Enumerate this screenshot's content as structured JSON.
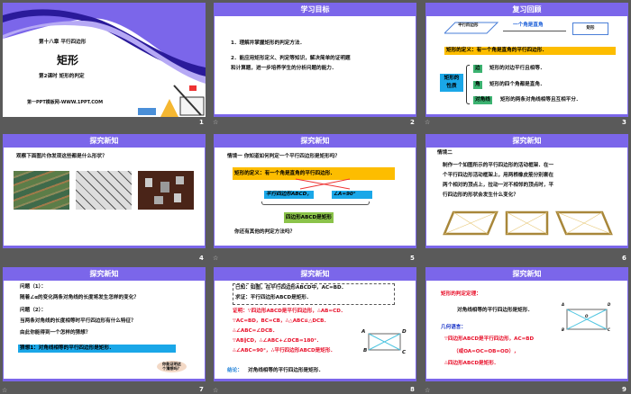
{
  "slides": [
    {
      "number": "1",
      "chapter": "第十八章  平行四边形",
      "title": "矩形",
      "lesson": "第2课时  矩形的判定",
      "site": "第一PPT模板网-WWW.1PPT.COM"
    },
    {
      "number": "2",
      "header": "学习目标",
      "items": [
        "1．理解并掌握矩形的判定方法．",
        "2．能应用矩形定义、判定等知识，解决简单的证明题",
        "和计算题，进一步培养学生的分析问题的能力．"
      ]
    },
    {
      "number": "3",
      "header": "复习回顾",
      "parallelogram": "平行四边形",
      "arrow_label": "一个角是直角",
      "rectangle": "矩形",
      "definition": "矩形的定义：有一个角是直角的平行四边形．",
      "property_label": [
        "矩形的",
        "性质"
      ],
      "properties": [
        {
          "tag": "边",
          "text": "矩形的对边平行且相等．"
        },
        {
          "tag": "角",
          "text": "矩形的四个角都是直角．"
        },
        {
          "tag": "对角线",
          "text": "矩形的两条对角线相等且互相平分．"
        }
      ]
    },
    {
      "number": "4",
      "header": "探究新知",
      "question": "观察下面图片你发现这些都是什么形状？"
    },
    {
      "number": "5",
      "header": "探究新知",
      "scenario": "情境一   你知道如何判定一个平行四边形是矩形吗？",
      "definition": "矩形的定义：有一个角是直角的平行四边形．",
      "cond1": "平行四边形ABCD，",
      "cond2": "∠A=90°",
      "result": "四边形ABCD是矩形",
      "other": "你还有其他的判定方法吗？"
    },
    {
      "number": "6",
      "header": "探究新知",
      "scenario": "情境二",
      "text": [
        "制作一个如图所示的平行四边形的活动框架．在一",
        "个平行四边形活动框架上，用两根橡皮筋分别套在",
        "两个相对的顶点上，拉动一对不相邻的顶点时，平",
        "行四边形的形状会发生什么变化？"
      ]
    },
    {
      "number": "7",
      "header": "探究新知",
      "q1_label": "问题（1）：",
      "q1": "随着∠α的变化两条对角线的长度将发生怎样的变化？",
      "q2_label": "问题（2）：",
      "q2": "当两条对角线的长度相等时平行四边形有什么特征？",
      "q3": "由此你能得到一个怎样的猜想？",
      "guess": "猜想1：对角线相等的平行四边形是矩形．",
      "bubble": [
        "你能证明这",
        "个猜想吗？"
      ]
    },
    {
      "number": "8",
      "header": "探究新知",
      "given": [
        "已知：如图，在平行四边形ABCD中，AC=BD．",
        "求证：平行四边形ABCD是矩形．"
      ],
      "proof": [
        "证明：∵四边形ABCD是平行四边形，∴AB=CD．",
        "∵AC=BD，BC=CB，∴△ABC≌△DCB．",
        "∴∠ABC=∠DCB．",
        "∵AB∥CD，∴∠ABC+∠DCB=180°．",
        "∴∠ABC=90°，∴平行四边形ABCD是矩形．"
      ],
      "conclusion_label": "结论：",
      "conclusion": "对角线相等的平行四边形是矩形．",
      "labels": [
        "A",
        "D",
        "B",
        "C"
      ]
    },
    {
      "number": "9",
      "header": "探究新知",
      "theorem_label": "矩形的判定定理：",
      "theorem": "对角线相等的平行四边形是矩形．",
      "geo_label": "几何语言：",
      "geo": [
        "∵四边形ABCD是平行四边形，AC=BD",
        "（或OA=OC=OB=OD），",
        "∴四边形ABCD是矩形．"
      ],
      "labels": [
        "A",
        "D",
        "O",
        "B",
        "C"
      ]
    }
  ],
  "colors": {
    "purple": "#7b66ea",
    "yellow": "#fdbd00",
    "cyan": "#1aa7e8",
    "green": "#3cb371"
  }
}
